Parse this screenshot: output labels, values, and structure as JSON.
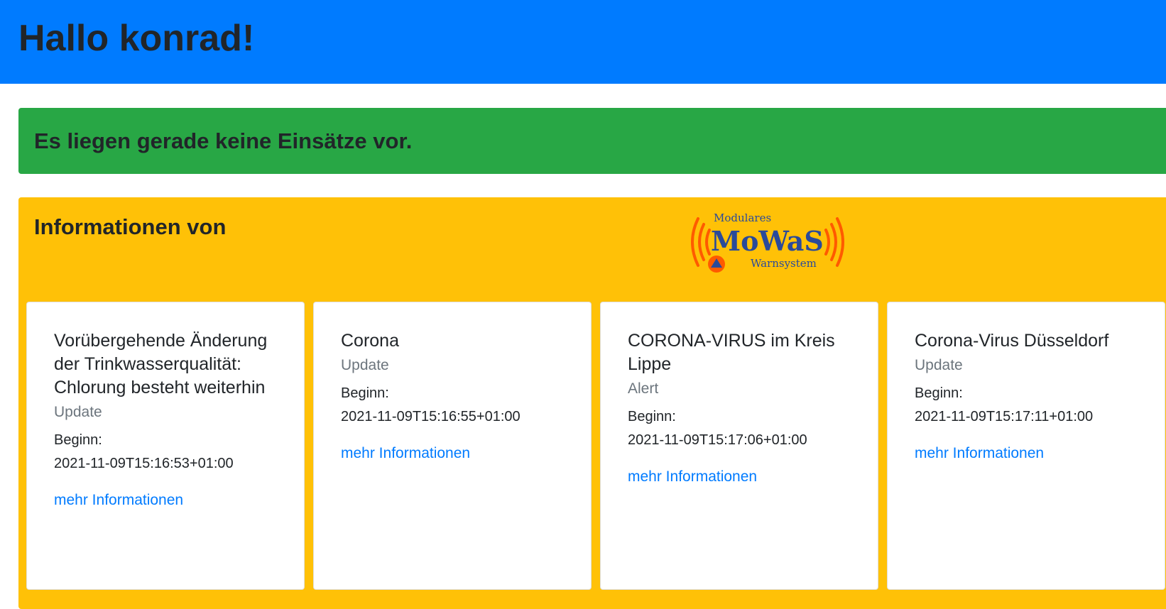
{
  "header": {
    "greeting": "Hallo konrad!"
  },
  "status_alert": {
    "message": "Es liegen gerade keine Einsätze vor."
  },
  "info_panel": {
    "title": "Informationen von",
    "logo": {
      "top_text": "Modulares",
      "main_text": "MoWaS",
      "bottom_text": "Warnsystem",
      "primary_color": "#2a4a9a",
      "wave_color": "#ff5a00"
    }
  },
  "cards": [
    {
      "title": "Vorübergehende Änderung der Trinkwasserqualität: Chlorung besteht weiterhin",
      "status": "Update",
      "begin_label": "Beginn:",
      "begin_value": "2021-11-09T15:16:53+01:00",
      "link_label": "mehr Informationen"
    },
    {
      "title": "Corona",
      "status": "Update",
      "begin_label": "Beginn:",
      "begin_value": "2021-11-09T15:16:55+01:00",
      "link_label": "mehr Informationen"
    },
    {
      "title": "CORONA-VIRUS im Kreis Lippe",
      "status": "Alert",
      "begin_label": "Beginn:",
      "begin_value": "2021-11-09T15:17:06+01:00",
      "link_label": "mehr Informationen"
    },
    {
      "title": "Corona-Virus Düsseldorf",
      "status": "Update",
      "begin_label": "Beginn:",
      "begin_value": "2021-11-09T15:17:11+01:00",
      "link_label": "mehr Informationen"
    }
  ],
  "colors": {
    "header_bg": "#007bff",
    "success_bg": "#28a745",
    "warning_bg": "#ffc107",
    "link": "#007bff",
    "muted": "#6c757d"
  }
}
